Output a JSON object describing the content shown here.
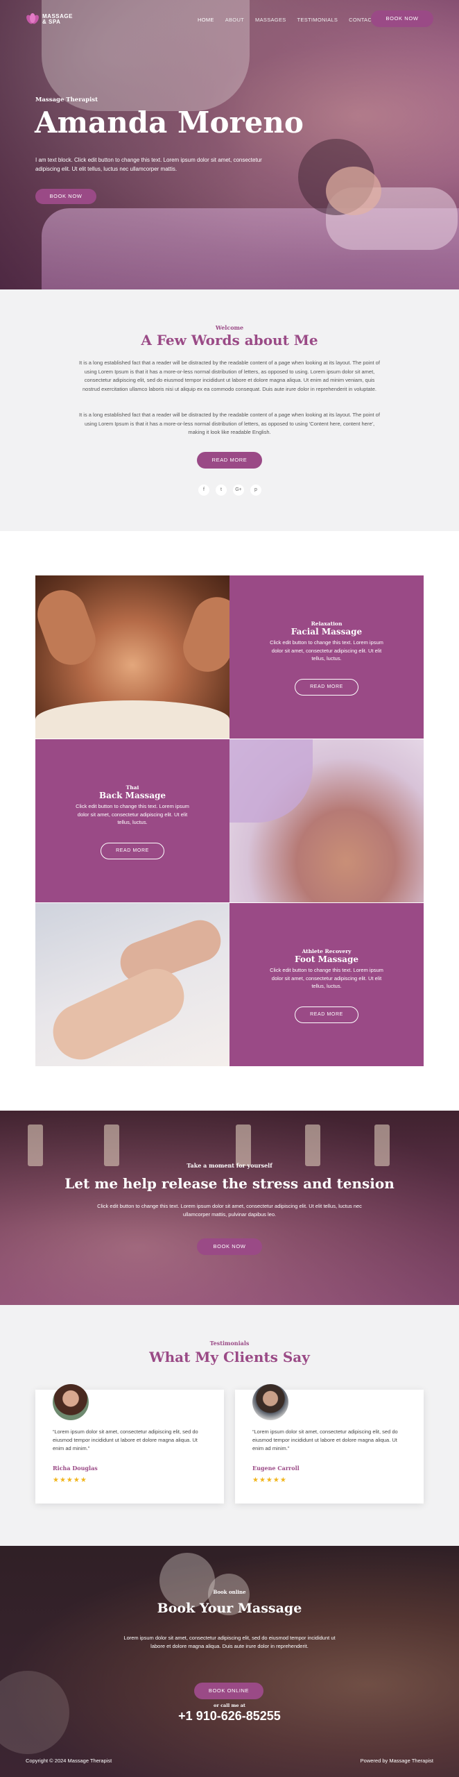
{
  "brand": {
    "line1": "MASSAGE",
    "line2": "& SPA"
  },
  "nav": {
    "items": [
      "HOME",
      "ABOUT",
      "MASSAGES",
      "TESTIMONIALS",
      "CONTACT"
    ],
    "book_label": "BOOK NOW"
  },
  "hero": {
    "subtitle": "Massage Therapist",
    "title": "Amanda Moreno",
    "text": "I am text block. Click edit button to change this text. Lorem ipsum dolor sit amet, consectetur adipiscing elit. Ut elit tellus, luctus nec ullamcorper mattis.",
    "button": "BOOK NOW"
  },
  "about": {
    "kicker": "Welcome",
    "title": "A Few Words about Me",
    "p1": "It is a long established fact that a reader will be distracted by the readable content of a page when looking at its layout. The point of using Lorem Ipsum is that it has a more-or-less normal distribution of letters, as opposed to using. Lorem ipsum dolor sit amet, consectetur adipiscing elit, sed do eiusmod tempor incididunt ut labore et dolore magna aliqua. Ut enim ad minim veniam, quis nostrud exercitation ullamco laboris nisi ut aliquip ex ea commodo consequat. Duis aute irure dolor in reprehenderit in voluptate.",
    "p2": "It is a long established fact that a reader will be distracted by the readable content of a page when looking at its layout. The point of using Lorem Ipsum is that it has a more-or-less normal distribution of letters, as opposed to using 'Content here, content here', making it look like readable English.",
    "button": "READ MORE",
    "socials": [
      "f",
      "t",
      "G+",
      "p"
    ]
  },
  "services": [
    {
      "kicker": "Relaxation",
      "title": "Facial Massage",
      "text": "Click edit button to change this text. Lorem ipsum dolor sit amet, consectetur adipiscing elit. Ut elit tellus, luctus.",
      "button": "READ MORE"
    },
    {
      "kicker": "Thai",
      "title": "Back Massage",
      "text": "Click edit button to change this text. Lorem ipsum dolor sit amet, consectetur adipiscing elit. Ut elit tellus, luctus.",
      "button": "READ MORE"
    },
    {
      "kicker": "Athlete Recovery",
      "title": "Foot Massage",
      "text": "Click edit button to change this text. Lorem ipsum dolor sit amet, consectetur adipiscing elit. Ut elit tellus, luctus.",
      "button": "READ MORE"
    }
  ],
  "cta": {
    "kicker": "Take a moment for yourself",
    "title": "Let me help release the stress and tension",
    "text": "Click edit button to change this text. Lorem ipsum dolor sit amet, consectetur adipiscing elit. Ut elit tellus, luctus nec ullamcorper mattis, pulvinar dapibus leo.",
    "button": "BOOK NOW"
  },
  "testimonials": {
    "kicker": "Testimonials",
    "title": "What My Clients Say",
    "items": [
      {
        "quote": "“Lorem ipsum dolor sit amet, consectetur adipiscing elit, sed do eiusmod tempor incididunt ut labore et dolore magna aliqua. Ut enim ad minim.”",
        "name": "Richa Douglas",
        "stars": "★★★★★"
      },
      {
        "quote": "“Lorem ipsum dolor sit amet, consectetur adipiscing elit, sed do eiusmod tempor incididunt ut labore et dolore magna aliqua. Ut enim ad minim.”",
        "name": "Eugene Carroll",
        "stars": "★★★★★"
      }
    ]
  },
  "booking": {
    "kicker": "Book online",
    "title": "Book Your Massage",
    "text": "Lorem ipsum dolor sit amet, consectetur adipiscing elit, sed do eiusmod tempor incididunt ut labore et dolore magna aliqua. Duis aute irure dolor in reprehenderit.",
    "button": "BOOK ONLINE",
    "call_label": "or call me at",
    "phone": "+1 910-626-85255"
  },
  "footer": {
    "copyright": "Copyright © 2024 Massage Therapist",
    "powered": "Powered by Massage Therapist"
  },
  "colors": {
    "accent": "#9a4a86",
    "star": "#f1b51c",
    "section_bg": "#f2f2f3"
  }
}
